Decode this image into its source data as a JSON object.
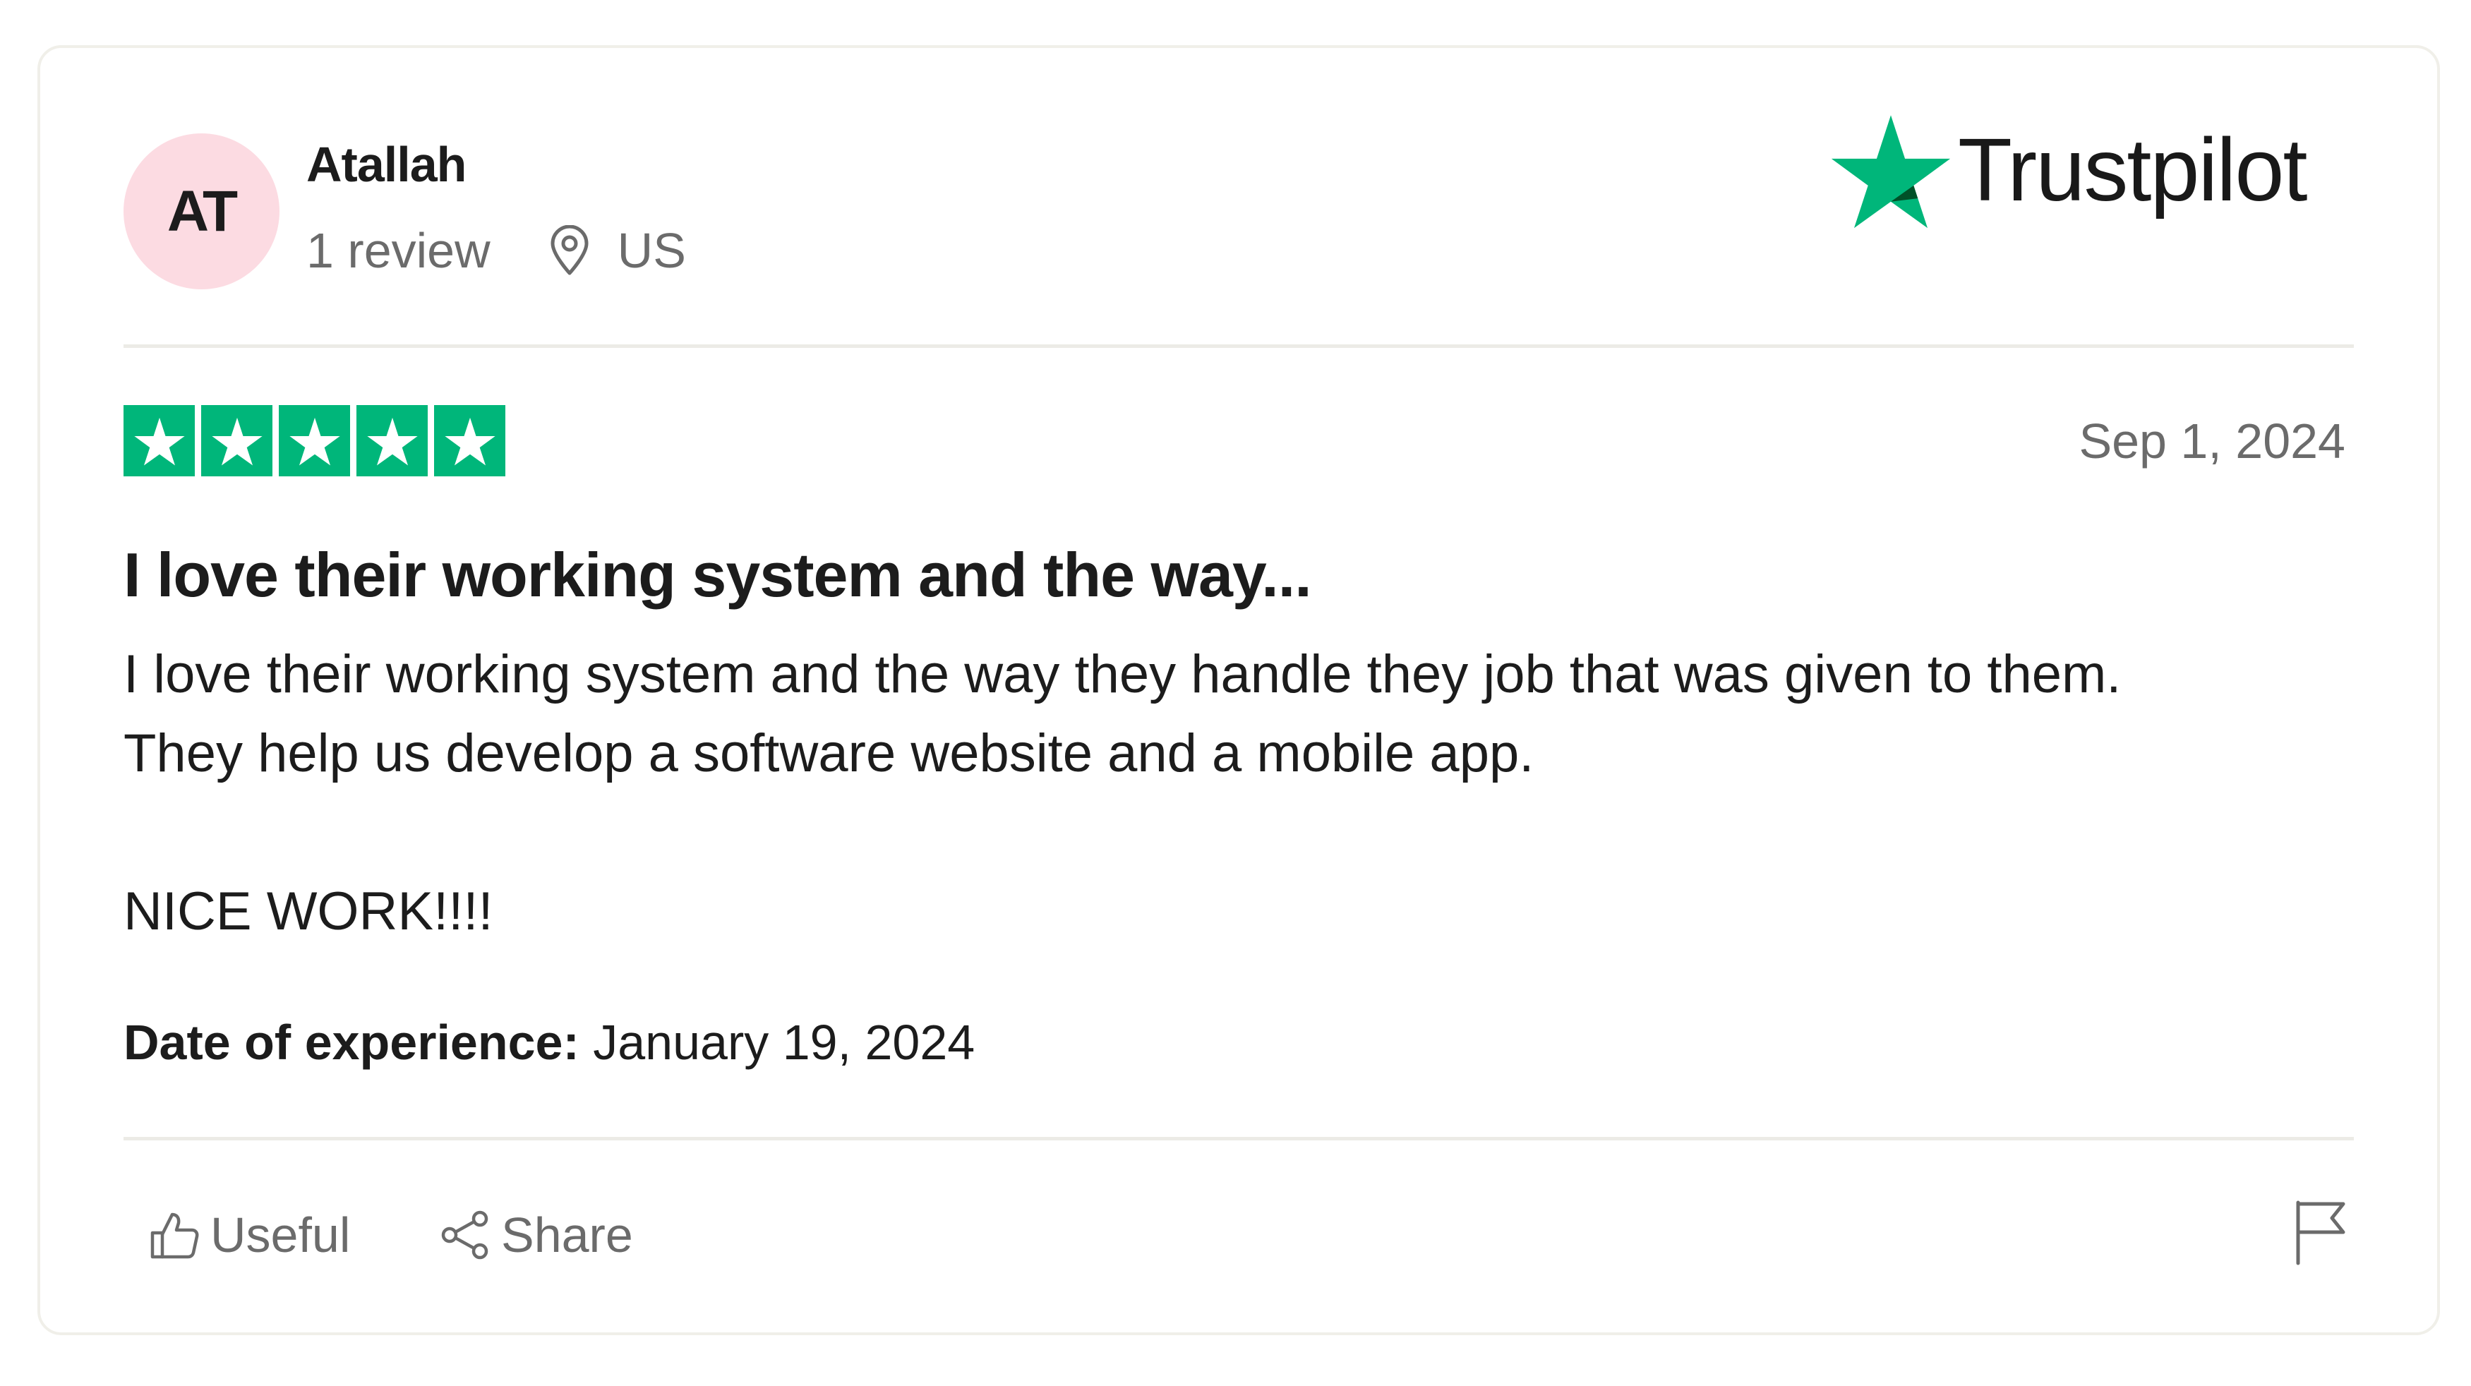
{
  "reviewer": {
    "initials": "AT",
    "name": "Atallah",
    "review_count": "1 review",
    "country": "US",
    "avatar_color": "#fcdbe2"
  },
  "brand": {
    "name": "Trustpilot",
    "color": "#00b67a"
  },
  "review": {
    "rating": 5,
    "rating_max": 5,
    "date": "Sep 1, 2024",
    "title": "I love their working system and the way...",
    "body_line_1": "I love their working system and the way they handle they job that was given to them.",
    "body_line_2": "They help us develop a software website and a mobile app.",
    "body_line_3": "NICE WORK!!!!",
    "experience_label": "Date of experience:",
    "experience_date": "January 19, 2024"
  },
  "actions": {
    "useful_label": "Useful",
    "share_label": "Share",
    "useful_icon": "thumbs-up-icon",
    "share_icon": "share-icon",
    "report_icon": "flag-icon"
  }
}
